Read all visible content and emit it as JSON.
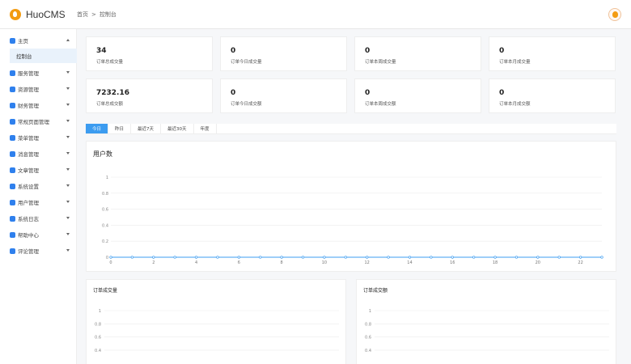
{
  "app": {
    "name": "HuoCMS"
  },
  "breadcrumb": {
    "home": "首页",
    "sep": ">",
    "current": "控制台"
  },
  "sidebar": {
    "items": [
      {
        "label": "主页",
        "icon": "home-icon",
        "expanded": true
      },
      {
        "label": "服务管理",
        "icon": "server-icon"
      },
      {
        "label": "资源管理",
        "icon": "resource-icon"
      },
      {
        "label": "财务管理",
        "icon": "finance-icon"
      },
      {
        "label": "常规页面管理",
        "icon": "page-icon"
      },
      {
        "label": "菜单管理",
        "icon": "menu-icon"
      },
      {
        "label": "消息管理",
        "icon": "message-icon"
      },
      {
        "label": "文章管理",
        "icon": "article-icon"
      },
      {
        "label": "系统设置",
        "icon": "settings-icon"
      },
      {
        "label": "用户管理",
        "icon": "user-icon"
      },
      {
        "label": "系统日志",
        "icon": "log-icon"
      },
      {
        "label": "帮助中心",
        "icon": "help-icon"
      },
      {
        "label": "评论管理",
        "icon": "comment-icon"
      }
    ],
    "subitem": {
      "label": "控制台"
    }
  },
  "stats": [
    {
      "value": "34",
      "label": "订单总成交量"
    },
    {
      "value": "0",
      "label": "订单今日成交量"
    },
    {
      "value": "0",
      "label": "订单本周成交量"
    },
    {
      "value": "0",
      "label": "订单本月成交量"
    },
    {
      "value": "7232.16",
      "label": "订单总成交额"
    },
    {
      "value": "0",
      "label": "订单今日成交额"
    },
    {
      "value": "0",
      "label": "订单本周成交额"
    },
    {
      "value": "0",
      "label": "订单本月成交额"
    }
  ],
  "tabs": [
    {
      "label": "今日",
      "active": true
    },
    {
      "label": "昨日"
    },
    {
      "label": "最近7天"
    },
    {
      "label": "最近30天"
    },
    {
      "label": "年度"
    }
  ],
  "colors": {
    "accent": "#3c9cf0",
    "brand": "#f39c12",
    "series": "#3c9cf0"
  },
  "chart_data": [
    {
      "type": "line",
      "title": "用户数",
      "x": [
        0,
        1,
        2,
        3,
        4,
        5,
        6,
        7,
        8,
        9,
        10,
        11,
        12,
        13,
        14,
        15,
        16,
        17,
        18,
        19,
        20,
        21,
        22,
        23
      ],
      "series": [
        {
          "values": [
            0,
            0,
            0,
            0,
            0,
            0,
            0,
            0,
            0,
            0,
            0,
            0,
            0,
            0,
            0,
            0,
            0,
            0,
            0,
            0,
            0,
            0,
            0,
            0
          ]
        }
      ],
      "xticks": [
        "0",
        "2",
        "4",
        "6",
        "8",
        "10",
        "12",
        "14",
        "16",
        "18",
        "20",
        "22"
      ],
      "yticks": [
        "0",
        "0.2",
        "0.4",
        "0.6",
        "0.8",
        "1"
      ],
      "ylim": [
        0,
        1
      ],
      "grid": true
    },
    {
      "type": "line",
      "title": "订单成交量",
      "yticks": [
        "0.4",
        "0.6",
        "0.8",
        "1"
      ],
      "ylim": [
        0,
        1
      ],
      "grid": true
    },
    {
      "type": "line",
      "title": "订单成交额",
      "yticks": [
        "0.4",
        "0.6",
        "0.8",
        "1"
      ],
      "ylim": [
        0,
        1
      ],
      "grid": true
    }
  ]
}
